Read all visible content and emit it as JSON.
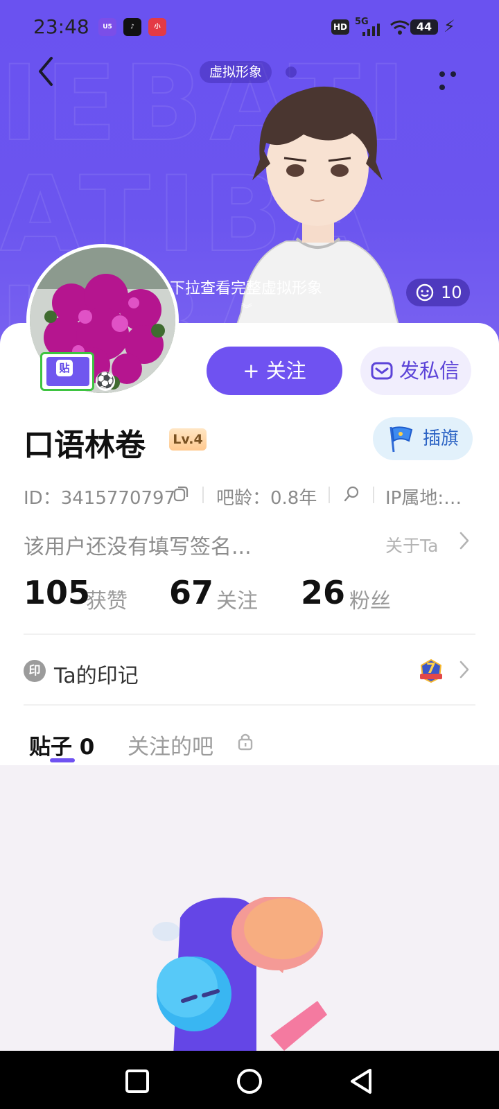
{
  "status_bar": {
    "time": "23:48",
    "notification_icons": [
      "app-icon-01",
      "tiktok-icon",
      "xiaohongshu-icon"
    ],
    "hd_label": "HD",
    "network_label": "5G",
    "battery": "44"
  },
  "header": {
    "title": "虚拟形象",
    "hint": "下拉查看完整虚拟形象",
    "like_count": "10"
  },
  "actions": {
    "follow_label": "+ 关注",
    "message_label": "发私信",
    "flag_label": "插旗"
  },
  "profile": {
    "username": "口语林卷",
    "level": "Lv.4",
    "badge_glyph": "贴",
    "id_text": "ID：3415770797",
    "age_text": "吧龄：0.8年",
    "ip_text": "IP属地:…",
    "signature": "该用户还没有填写签名...",
    "about_label": "关于Ta"
  },
  "stats": [
    {
      "value": "105",
      "label": "获赞"
    },
    {
      "value": "67",
      "label": "关注"
    },
    {
      "value": "26",
      "label": "粉丝"
    }
  ],
  "marks": {
    "icon_text": "印",
    "label": "Ta的印记",
    "badge_number": "7"
  },
  "tabs": [
    {
      "label": "贴子 0"
    },
    {
      "label": "关注的吧"
    }
  ],
  "colors": {
    "brand": "#6f52f1",
    "hero_bg": "#6a52f0"
  }
}
